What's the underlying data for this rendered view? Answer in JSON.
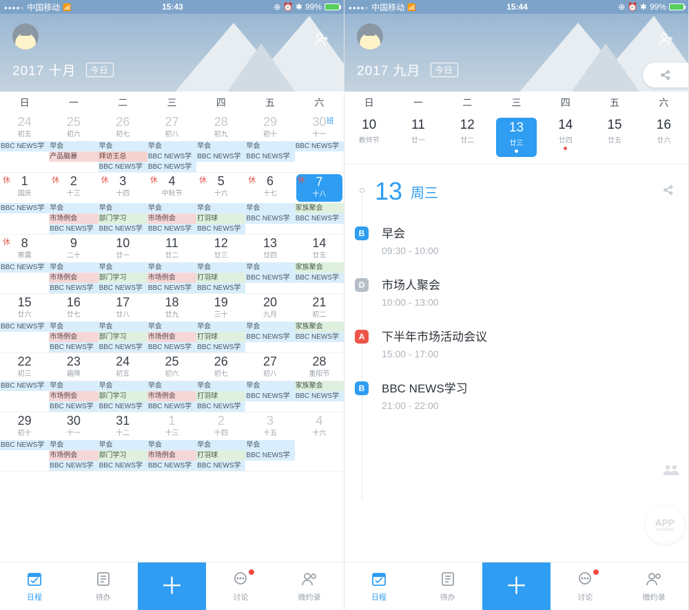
{
  "left": {
    "status": {
      "carrier": "中国移动",
      "time": "15:43",
      "battery": "99%",
      "icons": "⦿ ⏰ ⚡"
    },
    "header": {
      "title": "2017 十月",
      "today": "今日"
    },
    "weekdays": [
      "日",
      "一",
      "二",
      "三",
      "四",
      "五",
      "六"
    ],
    "weeks": [
      {
        "days": [
          {
            "num": "24",
            "lunar": "初五",
            "off": true
          },
          {
            "num": "25",
            "lunar": "初六",
            "off": true
          },
          {
            "num": "26",
            "lunar": "初七",
            "off": true
          },
          {
            "num": "27",
            "lunar": "初八",
            "off": true
          },
          {
            "num": "28",
            "lunar": "初九",
            "off": true
          },
          {
            "num": "29",
            "lunar": "初十",
            "off": true
          },
          {
            "num": "30",
            "lunar": "十一",
            "off": true,
            "work": "班"
          }
        ],
        "ev": [
          [
            {
              "t": "BBC NEWS学",
              "c": "blue"
            }
          ],
          [
            {
              "t": "早会",
              "c": "blue"
            },
            {
              "t": "产品脑暴",
              "c": "pink"
            }
          ],
          [
            {
              "t": "早会",
              "c": "blue"
            },
            {
              "t": "拜访王总",
              "c": "red"
            },
            {
              "t": "BBC NEWS学",
              "c": "blue"
            }
          ],
          [
            {
              "t": "早会",
              "c": "blue"
            },
            {
              "t": "BBC NEWS学",
              "c": "blue"
            },
            {
              "t": "BBC NEWS学",
              "c": "blue"
            }
          ],
          [
            {
              "t": "早会",
              "c": "blue"
            },
            {
              "t": "BBC NEWS学",
              "c": "blue"
            }
          ],
          [
            {
              "t": "早会",
              "c": "blue"
            },
            {
              "t": "BBC NEWS学",
              "c": "blue"
            }
          ],
          [
            {
              "t": "BBC NEWS学",
              "c": "blue"
            }
          ]
        ]
      },
      {
        "days": [
          {
            "num": "1",
            "lunar": "国庆",
            "hol": "休"
          },
          {
            "num": "2",
            "lunar": "十三",
            "hol": "休"
          },
          {
            "num": "3",
            "lunar": "十四",
            "hol": "休"
          },
          {
            "num": "4",
            "lunar": "中秋节",
            "hol": "休"
          },
          {
            "num": "5",
            "lunar": "十六",
            "hol": "休"
          },
          {
            "num": "6",
            "lunar": "十七",
            "hol": "休"
          },
          {
            "num": "7",
            "lunar": "十八",
            "hol": "休",
            "selected": true
          }
        ],
        "ev": [
          [
            {
              "t": "BBC NEWS学",
              "c": "blue"
            }
          ],
          [
            {
              "t": "早会",
              "c": "blue"
            },
            {
              "t": "市场例会",
              "c": "pink"
            },
            {
              "t": "BBC NEWS学",
              "c": "blue"
            }
          ],
          [
            {
              "t": "早会",
              "c": "blue"
            },
            {
              "t": "部门学习",
              "c": "green"
            },
            {
              "t": "BBC NEWS学",
              "c": "blue"
            }
          ],
          [
            {
              "t": "早会",
              "c": "blue"
            },
            {
              "t": "市场例会",
              "c": "pink"
            },
            {
              "t": "BBC NEWS学",
              "c": "blue"
            }
          ],
          [
            {
              "t": "早会",
              "c": "blue"
            },
            {
              "t": "打羽球",
              "c": "green"
            },
            {
              "t": "BBC NEWS学",
              "c": "blue"
            }
          ],
          [
            {
              "t": "早会",
              "c": "blue"
            },
            {
              "t": "BBC NEWS学",
              "c": "blue"
            }
          ],
          [
            {
              "t": "家族聚会",
              "c": "green"
            },
            {
              "t": "BBC NEWS学",
              "c": "blue"
            }
          ]
        ]
      },
      {
        "days": [
          {
            "num": "8",
            "lunar": "寒露",
            "hol": "休"
          },
          {
            "num": "9",
            "lunar": "二十"
          },
          {
            "num": "10",
            "lunar": "廿一"
          },
          {
            "num": "11",
            "lunar": "廿二"
          },
          {
            "num": "12",
            "lunar": "廿三"
          },
          {
            "num": "13",
            "lunar": "廿四"
          },
          {
            "num": "14",
            "lunar": "廿五"
          }
        ],
        "ev": [
          [
            {
              "t": "BBC NEWS学",
              "c": "blue"
            }
          ],
          [
            {
              "t": "早会",
              "c": "blue"
            },
            {
              "t": "市场例会",
              "c": "pink"
            },
            {
              "t": "BBC NEWS学",
              "c": "blue"
            }
          ],
          [
            {
              "t": "早会",
              "c": "blue"
            },
            {
              "t": "部门学习",
              "c": "green"
            },
            {
              "t": "BBC NEWS学",
              "c": "blue"
            }
          ],
          [
            {
              "t": "早会",
              "c": "blue"
            },
            {
              "t": "市场例会",
              "c": "pink"
            },
            {
              "t": "BBC NEWS学",
              "c": "blue"
            }
          ],
          [
            {
              "t": "早会",
              "c": "blue"
            },
            {
              "t": "打羽球",
              "c": "green"
            },
            {
              "t": "BBC NEWS学",
              "c": "blue"
            }
          ],
          [
            {
              "t": "早会",
              "c": "blue"
            },
            {
              "t": "BBC NEWS学",
              "c": "blue"
            }
          ],
          [
            {
              "t": "家族聚会",
              "c": "green"
            },
            {
              "t": "BBC NEWS学",
              "c": "blue"
            }
          ]
        ]
      },
      {
        "days": [
          {
            "num": "15",
            "lunar": "廿六"
          },
          {
            "num": "16",
            "lunar": "廿七"
          },
          {
            "num": "17",
            "lunar": "廿八"
          },
          {
            "num": "18",
            "lunar": "廿九"
          },
          {
            "num": "19",
            "lunar": "三十"
          },
          {
            "num": "20",
            "lunar": "九月"
          },
          {
            "num": "21",
            "lunar": "初二"
          }
        ],
        "ev": [
          [
            {
              "t": "BBC NEWS学",
              "c": "blue"
            }
          ],
          [
            {
              "t": "早会",
              "c": "blue"
            },
            {
              "t": "市场例会",
              "c": "pink"
            },
            {
              "t": "BBC NEWS学",
              "c": "blue"
            }
          ],
          [
            {
              "t": "早会",
              "c": "blue"
            },
            {
              "t": "部门学习",
              "c": "green"
            },
            {
              "t": "BBC NEWS学",
              "c": "blue"
            }
          ],
          [
            {
              "t": "早会",
              "c": "blue"
            },
            {
              "t": "市场例会",
              "c": "pink"
            },
            {
              "t": "BBC NEWS学",
              "c": "blue"
            }
          ],
          [
            {
              "t": "早会",
              "c": "blue"
            },
            {
              "t": "打羽球",
              "c": "green"
            },
            {
              "t": "BBC NEWS学",
              "c": "blue"
            }
          ],
          [
            {
              "t": "早会",
              "c": "blue"
            },
            {
              "t": "BBC NEWS学",
              "c": "blue"
            }
          ],
          [
            {
              "t": "家族聚会",
              "c": "green"
            },
            {
              "t": "BBC NEWS学",
              "c": "blue"
            }
          ]
        ]
      },
      {
        "days": [
          {
            "num": "22",
            "lunar": "初三"
          },
          {
            "num": "23",
            "lunar": "霜降"
          },
          {
            "num": "24",
            "lunar": "初五"
          },
          {
            "num": "25",
            "lunar": "初六"
          },
          {
            "num": "26",
            "lunar": "初七"
          },
          {
            "num": "27",
            "lunar": "初八"
          },
          {
            "num": "28",
            "lunar": "重阳节"
          }
        ],
        "ev": [
          [
            {
              "t": "BBC NEWS学",
              "c": "blue"
            }
          ],
          [
            {
              "t": "早会",
              "c": "blue"
            },
            {
              "t": "市场例会",
              "c": "pink"
            },
            {
              "t": "BBC NEWS学",
              "c": "blue"
            }
          ],
          [
            {
              "t": "早会",
              "c": "blue"
            },
            {
              "t": "部门学习",
              "c": "green"
            },
            {
              "t": "BBC NEWS学",
              "c": "blue"
            }
          ],
          [
            {
              "t": "早会",
              "c": "blue"
            },
            {
              "t": "市场例会",
              "c": "pink"
            },
            {
              "t": "BBC NEWS学",
              "c": "blue"
            }
          ],
          [
            {
              "t": "早会",
              "c": "blue"
            },
            {
              "t": "打羽球",
              "c": "green"
            },
            {
              "t": "BBC NEWS学",
              "c": "blue"
            }
          ],
          [
            {
              "t": "早会",
              "c": "blue"
            },
            {
              "t": "BBC NEWS学",
              "c": "blue"
            }
          ],
          [
            {
              "t": "家族聚会",
              "c": "green"
            },
            {
              "t": "BBC NEWS学",
              "c": "blue"
            }
          ]
        ]
      },
      {
        "days": [
          {
            "num": "29",
            "lunar": "初十"
          },
          {
            "num": "30",
            "lunar": "十一"
          },
          {
            "num": "31",
            "lunar": "十二"
          },
          {
            "num": "1",
            "lunar": "十三",
            "off": true
          },
          {
            "num": "2",
            "lunar": "十四",
            "off": true
          },
          {
            "num": "3",
            "lunar": "十五",
            "off": true
          },
          {
            "num": "4",
            "lunar": "十六",
            "off": true
          }
        ],
        "ev": [
          [
            {
              "t": "BBC NEWS学",
              "c": "blue"
            }
          ],
          [
            {
              "t": "早会",
              "c": "blue"
            },
            {
              "t": "市场例会",
              "c": "pink"
            },
            {
              "t": "BBC NEWS学",
              "c": "blue"
            }
          ],
          [
            {
              "t": "早会",
              "c": "blue"
            },
            {
              "t": "部门学习",
              "c": "green"
            },
            {
              "t": "BBC NEWS学",
              "c": "blue"
            }
          ],
          [
            {
              "t": "早会",
              "c": "blue"
            },
            {
              "t": "市场例会",
              "c": "pink"
            },
            {
              "t": "BBC NEWS学",
              "c": "blue"
            }
          ],
          [
            {
              "t": "早会",
              "c": "blue"
            },
            {
              "t": "打羽球",
              "c": "green"
            },
            {
              "t": "BBC NEWS学",
              "c": "blue"
            }
          ],
          [
            {
              "t": "早会",
              "c": "blue"
            },
            {
              "t": "BBC NEWS学",
              "c": "blue"
            }
          ],
          []
        ]
      }
    ],
    "tabs": [
      "日程",
      "待办",
      "",
      "讨论",
      "微约录"
    ]
  },
  "right": {
    "status": {
      "carrier": "中国移动",
      "time": "15:44",
      "battery": "99%"
    },
    "header": {
      "title": "2017 九月",
      "today": "今日"
    },
    "weekdays": [
      "日",
      "一",
      "二",
      "三",
      "四",
      "五",
      "六"
    ],
    "strip": [
      {
        "num": "10",
        "sub": "教师节"
      },
      {
        "num": "11",
        "sub": "廿一"
      },
      {
        "num": "12",
        "sub": "廿二"
      },
      {
        "num": "13",
        "sub": "廿三",
        "sel": true,
        "dot": "white"
      },
      {
        "num": "14",
        "sub": "廿四",
        "dot": "red"
      },
      {
        "num": "15",
        "sub": "廿五"
      },
      {
        "num": "16",
        "sub": "廿六"
      }
    ],
    "agenda": {
      "bignum": "13",
      "wd": "周三",
      "items": [
        {
          "badge": "B",
          "title": "早会",
          "time": "09:30 - 10:00"
        },
        {
          "badge": "D",
          "title": "市场人聚会",
          "time": "10:00 - 13:00"
        },
        {
          "badge": "A",
          "title": "下半年市场活动会议",
          "time": "15:00 - 17:00"
        },
        {
          "badge": "B",
          "title": "BBC NEWS学习",
          "time": "21:00 - 22:00"
        }
      ]
    },
    "tabs": [
      "日程",
      "待办",
      "",
      "讨论",
      "微约录"
    ],
    "watermark": {
      "big": "APP",
      "small": "solution"
    }
  }
}
